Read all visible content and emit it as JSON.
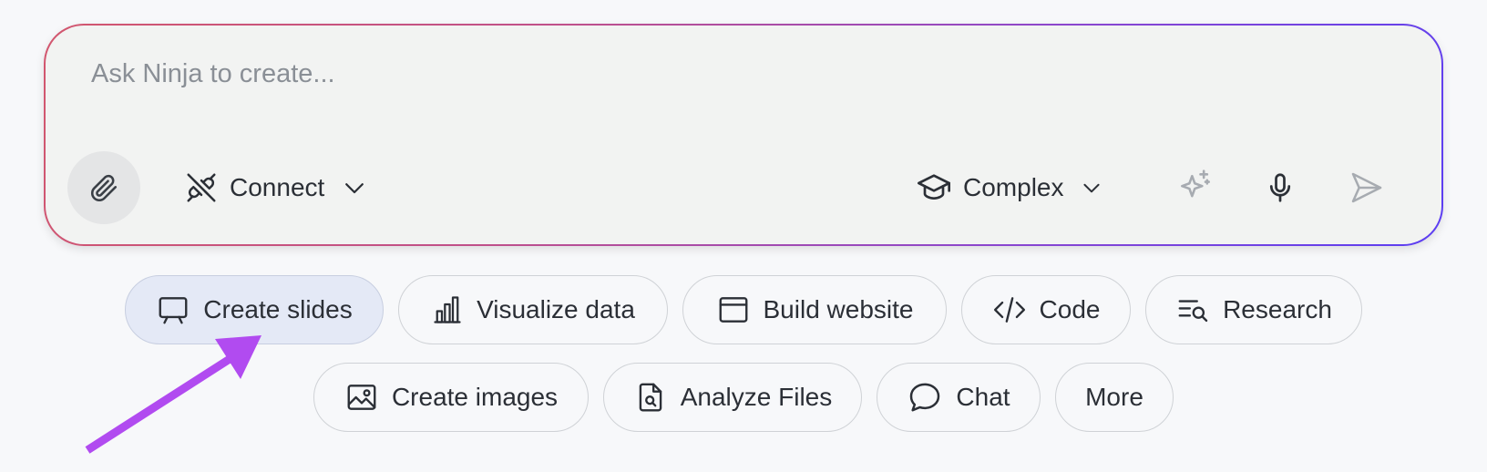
{
  "prompt": {
    "placeholder": "Ask Ninja to create..."
  },
  "toolbar": {
    "connect_label": "Connect",
    "mode_label": "Complex"
  },
  "chips": {
    "create_slides": "Create slides",
    "visualize_data": "Visualize data",
    "build_website": "Build website",
    "code": "Code",
    "research": "Research",
    "create_images": "Create images",
    "analyze_files": "Analyze Files",
    "chat": "Chat",
    "more": "More"
  },
  "colors": {
    "annotation_arrow": "#b14bf0",
    "border_gradient_start": "#d2566e",
    "border_gradient_end": "#5b3ef2",
    "active_chip_bg": "#e4e9f6"
  },
  "icons": {
    "attach": "paperclip-icon",
    "connect": "plug-disconnected-icon",
    "connect_dropdown": "chevron-down-icon",
    "mode": "graduation-cap-icon",
    "mode_dropdown": "chevron-down-icon",
    "enhance": "sparkle-icon",
    "voice": "microphone-icon",
    "send": "send-icon"
  }
}
